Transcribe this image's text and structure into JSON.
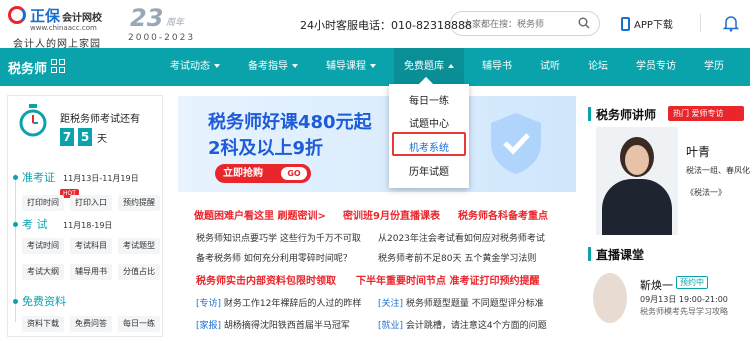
{
  "header": {
    "logo_name": "正保",
    "logo_sub": "会计网校",
    "logo_domain": "www.chinaacc.com",
    "slogan": "会计人的网上家园",
    "anniv_num": "23",
    "anniv_unit": "周年",
    "anniv_years": "2000-2023",
    "hotline": "24小时客服电话：010-82318888",
    "search_placeholder": "大家都在搜：税务师",
    "app_label": "APP下载"
  },
  "nav": {
    "brand": "税务师",
    "items": [
      "考试动态",
      "备考指导",
      "辅导课程",
      "免费题库",
      "辅导书",
      "试听",
      "论坛",
      "学员专访",
      "学历"
    ],
    "active_index": 3,
    "dropdown": [
      "每日一练",
      "试题中心",
      "机考系统",
      "历年试题"
    ],
    "dropdown_highlight": 2
  },
  "countdown": {
    "title": "距税务师考试还有",
    "digits": [
      "7",
      "5"
    ],
    "unit": "天"
  },
  "schedule": {
    "sections": [
      {
        "title": "准考证",
        "date": "11月13日-11月19日",
        "tags": [
          "打印时间",
          "打印入口",
          "预约提醒"
        ],
        "hot": "HOT"
      },
      {
        "title": "考  试",
        "date": "11月18-19日",
        "tags": [
          "考试时间",
          "考试科目",
          "考试题型",
          "考试大纲",
          "辅导用书",
          "分值占比"
        ]
      },
      {
        "title": "免费资料",
        "date": "",
        "tags": [
          "资料下载",
          "免费问答",
          "每日一练"
        ]
      }
    ]
  },
  "banner": {
    "line1": "税务师好课480元起",
    "line2": "2科及以上9折",
    "cta": "立即抢购",
    "go": "GO"
  },
  "news": {
    "headline1": [
      "做题困难户看这里 刷题密训>",
      "密训班9月份直播课表",
      "税务师各科备考重点"
    ],
    "text1": [
      "税务师知识点要巧学 这些行为千万不可取",
      "从2023年注会考试看如何应对税务师考试"
    ],
    "text2": [
      "备考税务师 如何充分利用零碎时间呢？",
      "税务师考前不足80天 五个黄金学习法则"
    ],
    "headline2": [
      "税务师实击内部资料包限时领取",
      "下半年重要时间节点 准考证打印预约提醒"
    ],
    "tagged": [
      {
        "tag": "[专访]",
        "text": "财务工作12年裸辞后的人过的昨样"
      },
      {
        "tag": "[关注]",
        "text": "税务师题型题量 不同题型评分标准"
      },
      {
        "tag": "[家报]",
        "text": "胡杨摘得沈阳铁西首届半马冠军"
      },
      {
        "tag": "[就业]",
        "text": "会计跳槽，请注意这4个方面的问题"
      }
    ]
  },
  "sidebar": {
    "teacher_title": "税务师讲师",
    "hot_badge": "热门 爱师专访",
    "teacher_name": "叶青",
    "teacher_desc": "税法一组、春风化",
    "teacher_book": "《税法一》",
    "live_title": "直播课堂",
    "live_name": "靳焕一",
    "live_badge": "预约中",
    "live_time": "09月13日 19:00-21:00",
    "live_topic": "税务师模考先导学习攻略"
  }
}
